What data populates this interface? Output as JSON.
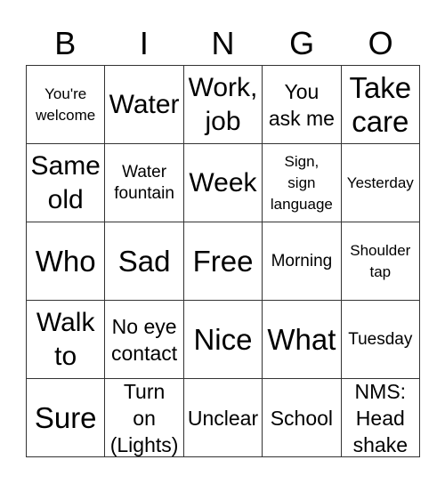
{
  "header": {
    "letters": [
      "B",
      "I",
      "N",
      "G",
      "O"
    ]
  },
  "board": {
    "rows": [
      [
        {
          "text": "You're\nwelcome",
          "size": "xs"
        },
        {
          "text": "Water",
          "size": "lg"
        },
        {
          "text": "Work,\njob",
          "size": "lg"
        },
        {
          "text": "You\nask me",
          "size": "md"
        },
        {
          "text": "Take\ncare",
          "size": "xl"
        }
      ],
      [
        {
          "text": "Same\nold",
          "size": "lg"
        },
        {
          "text": "Water\nfountain",
          "size": "sm"
        },
        {
          "text": "Week",
          "size": "lg"
        },
        {
          "text": "Sign,\nsign\nlanguage",
          "size": "xs"
        },
        {
          "text": "Yesterday",
          "size": "xs"
        }
      ],
      [
        {
          "text": "Who",
          "size": "xl"
        },
        {
          "text": "Sad",
          "size": "xl"
        },
        {
          "text": "Free",
          "size": "xl"
        },
        {
          "text": "Morning",
          "size": "sm"
        },
        {
          "text": "Shoulder\ntap",
          "size": "xs"
        }
      ],
      [
        {
          "text": "Walk\nto",
          "size": "lg"
        },
        {
          "text": "No eye\ncontact",
          "size": "md"
        },
        {
          "text": "Nice",
          "size": "xl"
        },
        {
          "text": "What",
          "size": "xl"
        },
        {
          "text": "Tuesday",
          "size": "sm"
        }
      ],
      [
        {
          "text": "Sure",
          "size": "xl"
        },
        {
          "text": "Turn\non\n(Lights)",
          "size": "md"
        },
        {
          "text": "Unclear",
          "size": "md"
        },
        {
          "text": "School",
          "size": "md"
        },
        {
          "text": "NMS:\nHead\nshake",
          "size": "md"
        }
      ]
    ]
  }
}
